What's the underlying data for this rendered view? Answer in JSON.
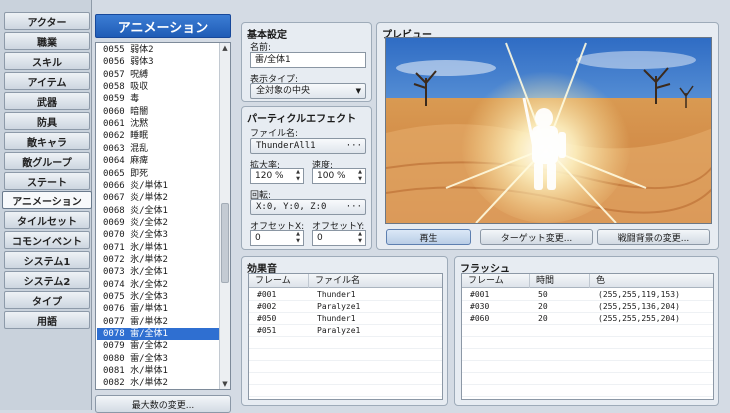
{
  "tabs": [
    "アクター",
    "職業",
    "スキル",
    "アイテム",
    "武器",
    "防具",
    "敵キャラ",
    "敵グループ",
    "ステート",
    "アニメーション",
    "タイルセット",
    "コモンイベント",
    "システム1",
    "システム2",
    "タイプ",
    "用語"
  ],
  "active_tab": "アニメーション",
  "list": {
    "title": "アニメーション",
    "rows": [
      "0055 弱体2",
      "0056 弱体3",
      "0057 呪縛",
      "0058 吸収",
      "0059 毒",
      "0060 暗闇",
      "0061 沈黙",
      "0062 睡眠",
      "0063 混乱",
      "0064 麻痺",
      "0065 即死",
      "0066 炎/単体1",
      "0067 炎/単体2",
      "0068 炎/全体1",
      "0069 炎/全体2",
      "0070 炎/全体3",
      "0071 氷/単体1",
      "0072 氷/単体2",
      "0073 氷/全体1",
      "0074 氷/全体2",
      "0075 氷/全体3",
      "0076 雷/単体1",
      "0077 雷/単体2",
      "0078 雷/全体1",
      "0079 雷/全体2",
      "0080 雷/全体3",
      "0081 水/単体1",
      "0082 水/単体2"
    ],
    "selected": "0078 雷/全体1",
    "max_button": "最大数の変更..."
  },
  "basic": {
    "title": "基本設定",
    "name_label": "名前:",
    "name_value": "雷/全体1",
    "display_label": "表示タイプ:",
    "display_value": "全対象の中央"
  },
  "particle": {
    "title": "パーティクルエフェクト",
    "file_label": "ファイル名:",
    "file_value": "ThunderAll1",
    "scale_label": "拡大率:",
    "scale_value": "120 %",
    "speed_label": "速度:",
    "speed_value": "100 %",
    "rotation_label": "回転:",
    "rotation_value": "X:0, Y:0, Z:0",
    "offx_label": "オフセットX:",
    "offx_value": "0",
    "offy_label": "オフセットY:",
    "offy_value": "0"
  },
  "preview": {
    "title": "プレビュー",
    "play_button": "再生",
    "target_button": "ターゲット変更...",
    "background_button": "戦闘背景の変更..."
  },
  "sound": {
    "title": "効果音",
    "headers": [
      "フレーム",
      "ファイル名"
    ],
    "rows": [
      [
        "#001",
        "Thunder1"
      ],
      [
        "#002",
        "Paralyze1"
      ],
      [
        "#050",
        "Thunder1"
      ],
      [
        "#051",
        "Paralyze1"
      ]
    ]
  },
  "flash": {
    "title": "フラッシュ",
    "headers": [
      "フレーム",
      "時間",
      "色"
    ],
    "rows": [
      [
        "#001",
        "50",
        "(255,255,119,153)"
      ],
      [
        "#030",
        "20",
        "(255,255,136,204)"
      ],
      [
        "#060",
        "20",
        "(255,255,255,204)"
      ]
    ]
  },
  "colors": {
    "accent": "#2f6fd1",
    "sand": "#e0a35c",
    "sky": "#3f7fd0"
  },
  "icons": {
    "dropdown": "chevron-down-icon",
    "ellipsis": "ellipsis-icon",
    "spin": "spinner-arrows-icon"
  }
}
